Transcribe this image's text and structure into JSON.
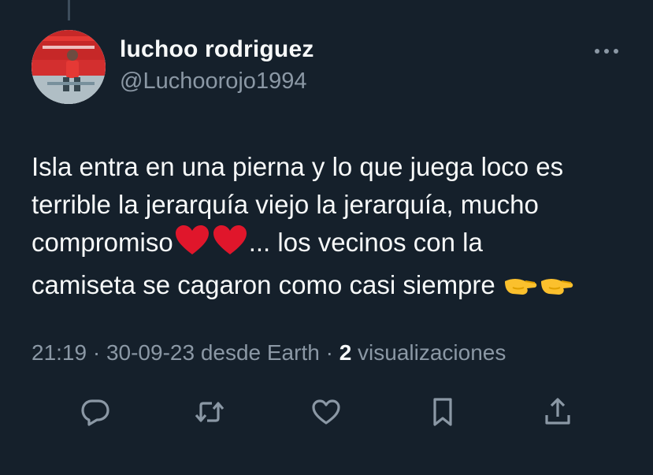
{
  "user": {
    "display_name": "luchoo rodriguez",
    "handle": "@Luchoorojo1994"
  },
  "tweet": {
    "line1": "Isla entra en una pierna y lo que juega loco es",
    "line2": "terrible la jerarquía viejo la jerarquía, mucho",
    "line3a": "compromiso",
    "line3b": "... los vecinos con la",
    "line4": "camiseta se cagaron como casi siempre "
  },
  "meta": {
    "time_date": "21:19 · 30-09-23 desde Earth · ",
    "views_count": "2",
    "views_label": " visualizaciones"
  },
  "icons": {
    "more": "more-horizontal-icon",
    "reply": "reply-icon",
    "retweet": "retweet-icon",
    "like": "heart-icon",
    "bookmark": "bookmark-icon",
    "share": "share-icon",
    "emoji_heart": "red-heart-emoji",
    "emoji_hand": "pinching-hand-emoji"
  },
  "colors": {
    "background": "#15202b",
    "primary_text": "#f7f9f9",
    "secondary_text": "#8b98a5",
    "icon": "#8b98a5"
  }
}
